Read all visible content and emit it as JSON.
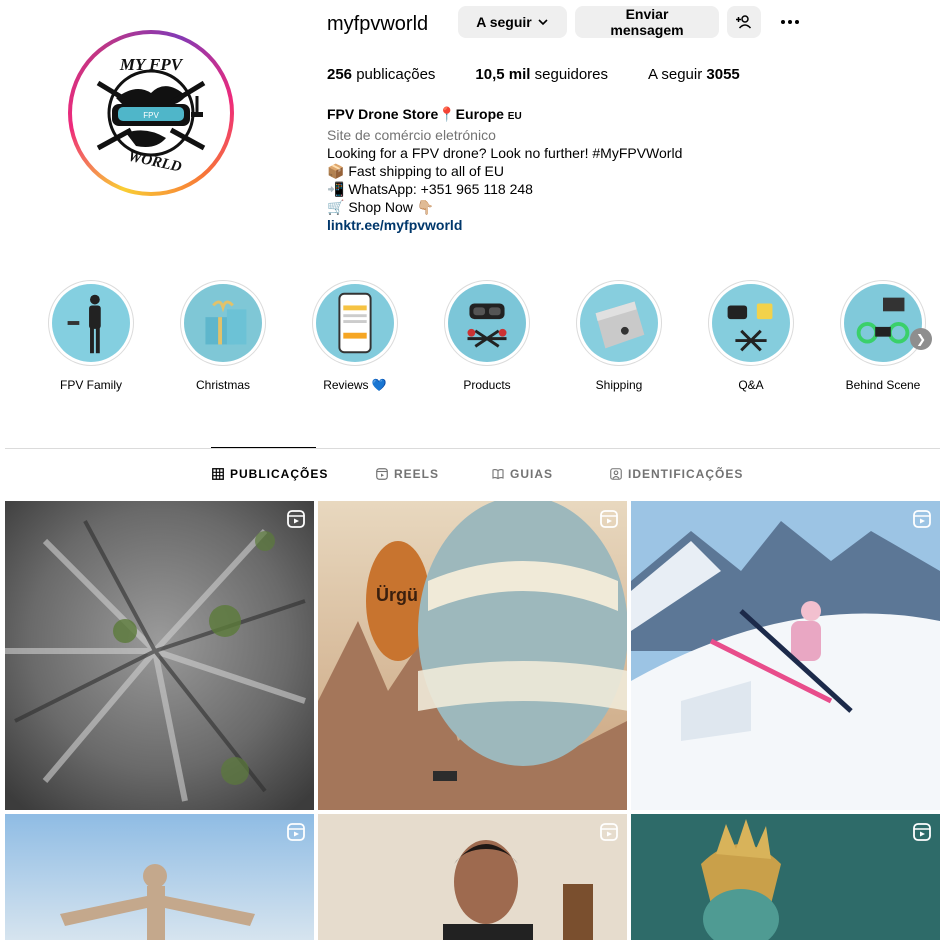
{
  "profile": {
    "username": "myfpvworld",
    "follow_label": "A seguir",
    "message_label": "Enviar mensagem",
    "stats": {
      "posts_count": "256",
      "posts_label": "publicações",
      "followers_count": "10,5 mil",
      "followers_label": "seguidores",
      "following_label": "A seguir",
      "following_count": "3055"
    },
    "bio": {
      "name": "FPV Drone Store📍Europe",
      "name_suffix": "EU",
      "category": "Site de comércio eletrónico",
      "line1": "Looking for a FPV drone? Look no further! #MyFPVWorld",
      "line2": "📦 Fast shipping to all of EU",
      "line3": "📲 WhatsApp: +351 965 118 248",
      "line4": "🛒 Shop Now 👇🏼",
      "link": "linktr.ee/myfpvworld"
    },
    "avatar_text_top": "MY FPV",
    "avatar_text_bottom": "WORLD",
    "avatar_text_goggles": "FPV"
  },
  "highlights": [
    {
      "label": "FPV Family"
    },
    {
      "label": "Christmas"
    },
    {
      "label": "Reviews 💙"
    },
    {
      "label": "Products"
    },
    {
      "label": "Shipping"
    },
    {
      "label": "Q&A"
    },
    {
      "label": "Behind Scene"
    }
  ],
  "tabs": [
    {
      "label": "PUBLICAÇÕES",
      "active": true
    },
    {
      "label": "REELS",
      "active": false
    },
    {
      "label": "GUIAS",
      "active": false
    },
    {
      "label": "IDENTIFICAÇÕES",
      "active": false
    }
  ],
  "posts": [
    {
      "type": "reel",
      "subject": "rocky-mountain-aerial"
    },
    {
      "type": "reel",
      "subject": "hot-air-balloons",
      "visible_text": "Ürgü"
    },
    {
      "type": "reel",
      "subject": "skier-jump"
    },
    {
      "type": "reel",
      "subject": "christ-statue"
    },
    {
      "type": "reel",
      "subject": "man-portrait"
    },
    {
      "type": "reel",
      "subject": "golden-statue"
    }
  ],
  "colors": {
    "link": "#00376b",
    "secondary_text": "#737373",
    "button_bg": "#efefef",
    "divider": "#dbdbdb"
  }
}
